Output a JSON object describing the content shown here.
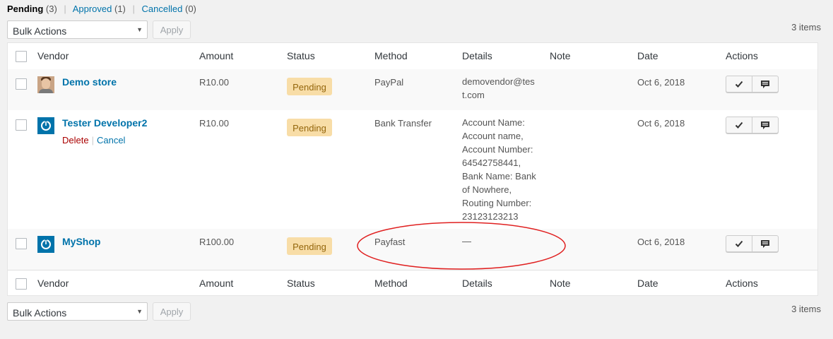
{
  "filters": {
    "pending": {
      "label": "Pending",
      "count": "(3)"
    },
    "approved": {
      "label": "Approved",
      "count": "(1)"
    },
    "cancelled": {
      "label": "Cancelled",
      "count": "(0)"
    },
    "separator": "|"
  },
  "tablenav": {
    "bulk_actions_label": "Bulk Actions",
    "apply_label": "Apply",
    "items_count": "3 items"
  },
  "columns": {
    "vendor": "Vendor",
    "amount": "Amount",
    "status": "Status",
    "method": "Method",
    "details": "Details",
    "note": "Note",
    "date": "Date",
    "actions": "Actions"
  },
  "rows": [
    {
      "vendor": "Demo store",
      "avatar": "photo-avatar",
      "amount": "R10.00",
      "status": "Pending",
      "method": "PayPal",
      "details": "demovendor@test.com",
      "note": "",
      "date": "Oct 6, 2018"
    },
    {
      "vendor": "Tester Developer2",
      "avatar": "wordpress-avatar",
      "row_actions": {
        "delete": "Delete",
        "cancel": "Cancel",
        "separator": "|"
      },
      "amount": "R10.00",
      "status": "Pending",
      "method": "Bank Transfer",
      "details": "Account Name: Account name, Account Number: 64542758441, Bank Name: Bank of Nowhere, Routing Number: 23123123213",
      "note": "",
      "date": "Oct 6, 2018"
    },
    {
      "vendor": "MyShop",
      "avatar": "wordpress-avatar",
      "amount": "R100.00",
      "status": "Pending",
      "method": "Payfast",
      "details": "—",
      "note": "",
      "date": "Oct 6, 2018"
    }
  ],
  "colors": {
    "link": "#0073aa",
    "pending_badge_bg": "#f8dda7",
    "pending_badge_text": "#94660c",
    "delete_link": "#aa0000",
    "annotation_ellipse": "#e02020"
  },
  "icons": {
    "approve": "checkmark-icon",
    "note": "comment-icon"
  }
}
